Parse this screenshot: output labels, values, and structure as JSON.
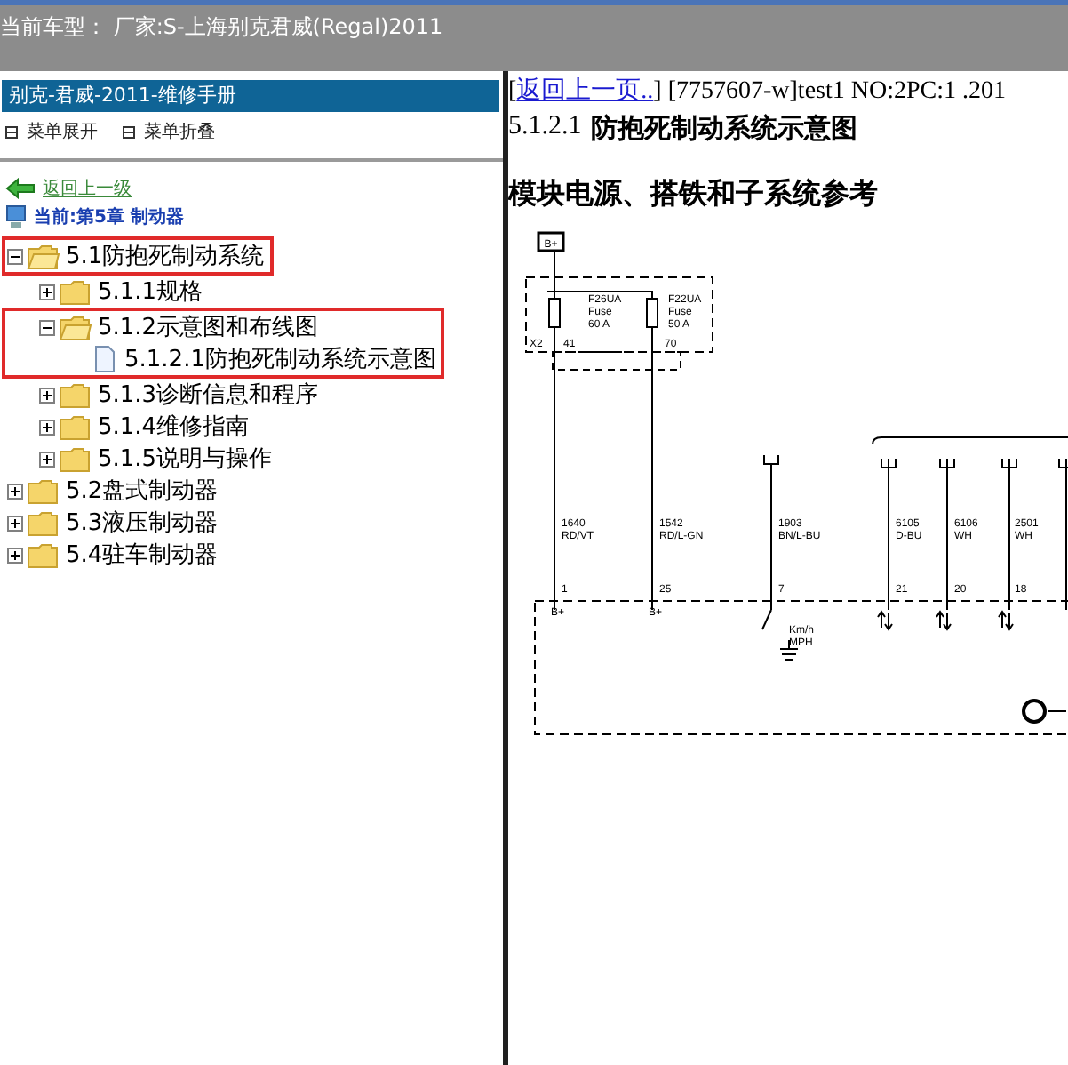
{
  "title_bar": {
    "label": "当前车型：",
    "value": "厂家:S-上海别克君威(Regal)2011"
  },
  "sidebar": {
    "header": "别克-君威-2011-维修手册",
    "toolbar": [
      "菜单展开",
      "菜单折叠"
    ],
    "back_link": "返回上一级",
    "current": "当前:第5章 制动器",
    "tree": [
      {
        "label": "5.1防抱死制动系统",
        "expanded": true,
        "outlined": true,
        "children": [
          {
            "label": "5.1.1规格",
            "expanded": false,
            "outlined": false
          },
          {
            "label": "5.1.2示意图和布线图",
            "expanded": true,
            "outlined": true,
            "children": [
              {
                "label": "5.1.2.1防抱死制动系统示意图",
                "kind": "page",
                "outlined": true
              }
            ]
          },
          {
            "label": "5.1.3诊断信息和程序",
            "expanded": false,
            "outlined": false
          },
          {
            "label": "5.1.4维修指南",
            "expanded": false,
            "outlined": false
          },
          {
            "label": "5.1.5说明与操作",
            "expanded": false,
            "outlined": false
          }
        ]
      },
      {
        "label": "5.2盘式制动器",
        "expanded": false,
        "outlined": false
      },
      {
        "label": "5.3液压制动器",
        "expanded": false,
        "outlined": false
      },
      {
        "label": "5.4驻车制动器",
        "expanded": false,
        "outlined": false
      }
    ]
  },
  "content": {
    "bracket": "[",
    "back_link": "返回上一页..",
    "info": "] [7757607-w]test1 NO:2PC:1 .201",
    "number": "5.1.2.1",
    "title": "防抱死制动系统示意图",
    "subtitle": "模块电源、搭铁和子系统参考",
    "diagram": {
      "labels": [
        "B+",
        "F26UA",
        "Fuse",
        "60 A",
        "F22UA",
        "Fuse",
        "50 A",
        "X2",
        "41",
        "70",
        "1640",
        "RD/VT",
        "1542",
        "RD/L-GN",
        "1903",
        "BN/L-BU",
        "6105",
        "D-BU",
        "6106",
        "WH",
        "2501",
        "WH",
        "1",
        "25",
        "7",
        "21",
        "20",
        "18",
        "B+",
        "B+",
        "Km/h",
        "MPH"
      ]
    }
  }
}
